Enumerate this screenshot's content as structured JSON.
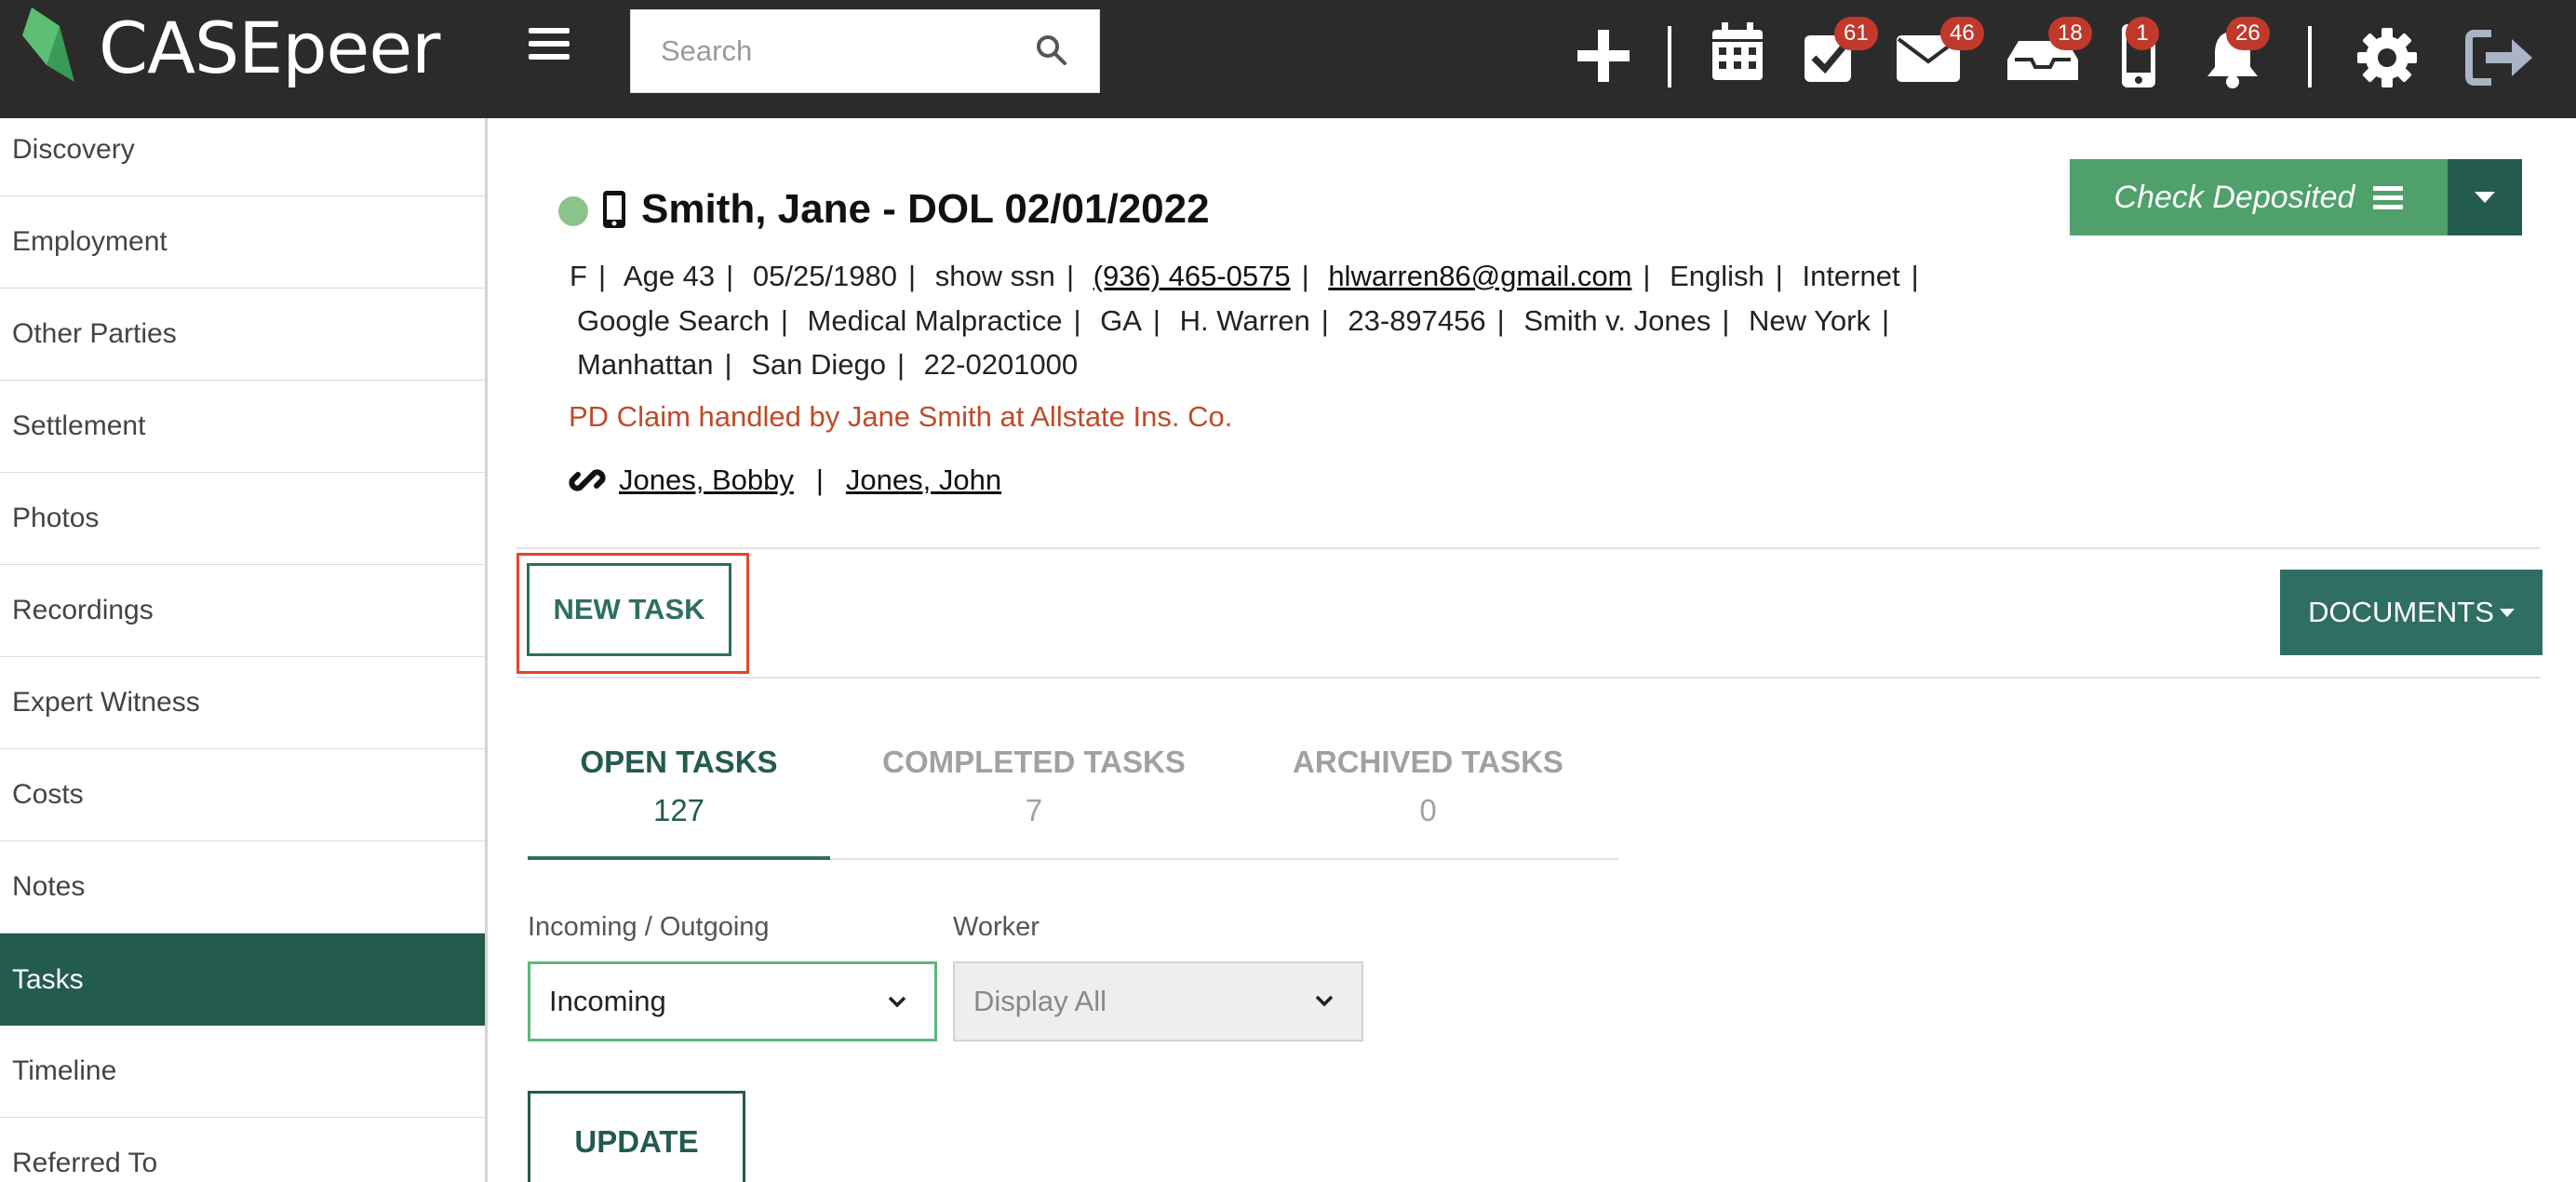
{
  "app": {
    "name": "CASEpeer"
  },
  "search": {
    "placeholder": "Search"
  },
  "toolbar": {
    "badges": {
      "tasks": "61",
      "mail": "46",
      "inbox": "18",
      "phone": "1",
      "notifications": "26"
    }
  },
  "sidebar": {
    "items": [
      {
        "label": "Discovery",
        "active": false
      },
      {
        "label": "Employment",
        "active": false
      },
      {
        "label": "Other Parties",
        "active": false
      },
      {
        "label": "Settlement",
        "active": false
      },
      {
        "label": "Photos",
        "active": false
      },
      {
        "label": "Recordings",
        "active": false
      },
      {
        "label": "Expert Witness",
        "active": false
      },
      {
        "label": "Costs",
        "active": false
      },
      {
        "label": "Notes",
        "active": false
      },
      {
        "label": "Tasks",
        "active": true
      },
      {
        "label": "Timeline",
        "active": false
      },
      {
        "label": "Referred To",
        "active": false
      }
    ]
  },
  "case": {
    "title": "Smith, Jane - DOL 02/01/2022",
    "status_color": "#8bc48a",
    "line1": {
      "gender": "F",
      "age": "Age 43",
      "dob": "05/25/1980",
      "ssn": "show ssn",
      "phone": "(936) 465-0575",
      "email": "hlwarren86@gmail.com",
      "language": "English",
      "source": "Internet"
    },
    "line2": [
      "Google Search",
      "Medical Malpractice",
      "GA",
      "H. Warren",
      "23-897456",
      "Smith v. Jones",
      "New York"
    ],
    "line3": [
      "Manhattan",
      "San Diego",
      "22-0201000"
    ],
    "claim_note": "PD Claim handled by Jane Smith at Allstate Ins. Co.",
    "related": [
      "Jones, Bobby",
      "Jones, John"
    ],
    "separator": "|"
  },
  "actions": {
    "check_deposited": "Check Deposited",
    "new_task": "NEW TASK",
    "documents": "DOCUMENTS",
    "update": "UPDATE"
  },
  "tabs": [
    {
      "label": "OPEN TASKS",
      "count": "127",
      "active": true
    },
    {
      "label": "COMPLETED TASKS",
      "count": "7",
      "active": false
    },
    {
      "label": "ARCHIVED TASKS",
      "count": "0",
      "active": false
    }
  ],
  "filters": {
    "direction": {
      "label": "Incoming / Outgoing",
      "value": "Incoming"
    },
    "worker": {
      "label": "Worker",
      "value": "Display All"
    }
  },
  "colors": {
    "brand_dark": "#235b4e",
    "brand_green": "#4fa06a",
    "accent_red": "#c0392b",
    "highlight": "#e5452b"
  }
}
